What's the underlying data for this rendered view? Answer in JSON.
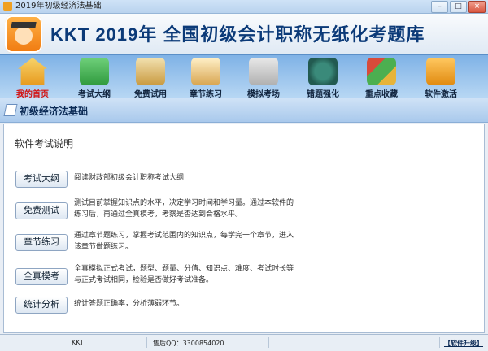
{
  "window": {
    "title": "2019年初级经济法基础",
    "buttons": [
      "–",
      "□",
      "×"
    ]
  },
  "banner": {
    "title": "KKT  2019年 全国初级会计职称无纸化考题库"
  },
  "toolbar": {
    "items": [
      {
        "label": "我的首页",
        "icon": "home-icon",
        "active": true
      },
      {
        "label": "考试大纲",
        "icon": "syllabus-icon"
      },
      {
        "label": "免费试用",
        "icon": "free-trial-icon"
      },
      {
        "label": "章节练习",
        "icon": "book-icon"
      },
      {
        "label": "模拟考场",
        "icon": "exam-room-icon"
      },
      {
        "label": "错题强化",
        "icon": "clock-icon"
      },
      {
        "label": "重点收藏",
        "icon": "collection-icon"
      },
      {
        "label": "软件激活",
        "icon": "lock-icon"
      }
    ]
  },
  "section": {
    "title": "初级经济法基础"
  },
  "panel": {
    "heading": "软件考试说明",
    "rows": [
      {
        "button": "考试大纲",
        "desc": "阅读财政部初级会计职称考试大纲"
      },
      {
        "button": "免费测试",
        "desc": "测试目前掌握知识点的水平，决定学习时间和学习量。通过本软件的练习后，再通过全真模考，考察是否达到合格水平。"
      },
      {
        "button": "章节练习",
        "desc": "通过章节题练习，掌握考试范围内的知识点，每学完一个章节，进入该章节做题练习。"
      },
      {
        "button": "全真模考",
        "desc": "全真模拟正式考试，题型、题量、分值、知识点、难度、考试时长等与正式考试相同，检验是否做好考试准备。"
      },
      {
        "button": "统计分析",
        "desc": "统计答题正确率，分析薄弱环节。"
      }
    ]
  },
  "status": {
    "brand": "KKT",
    "qq": "售后QQ：3300854020",
    "upgrade": "【软件升级】"
  }
}
